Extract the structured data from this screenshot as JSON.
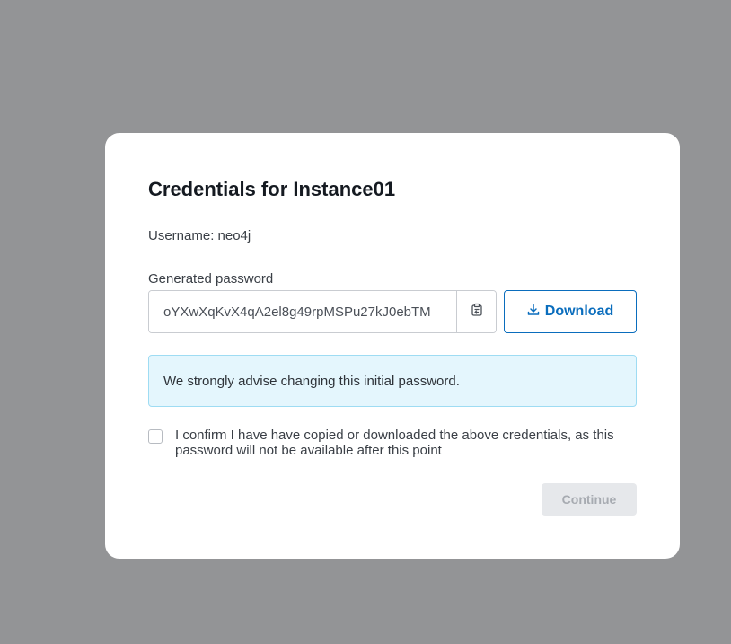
{
  "modal": {
    "title": "Credentials for Instance01",
    "username_label": "Username: neo4j",
    "password_label": "Generated password",
    "password_value": "oYXwXqKvX4qA2el8g49rpMSPu27kJ0ebTM",
    "download_label": "Download",
    "notice": "We strongly advise changing this initial password.",
    "confirm_text": "I confirm I have have copied or downloaded the above credentials, as this password will not be available after this point",
    "confirm_checked": false,
    "continue_label": "Continue",
    "continue_disabled": true
  },
  "icons": {
    "copy": "clipboard-copy-icon",
    "download": "download-icon"
  },
  "colors": {
    "backdrop": "#939496",
    "accent": "#0a6dbd",
    "notice_bg": "#e4f6fd",
    "notice_border": "#9edcf3"
  }
}
